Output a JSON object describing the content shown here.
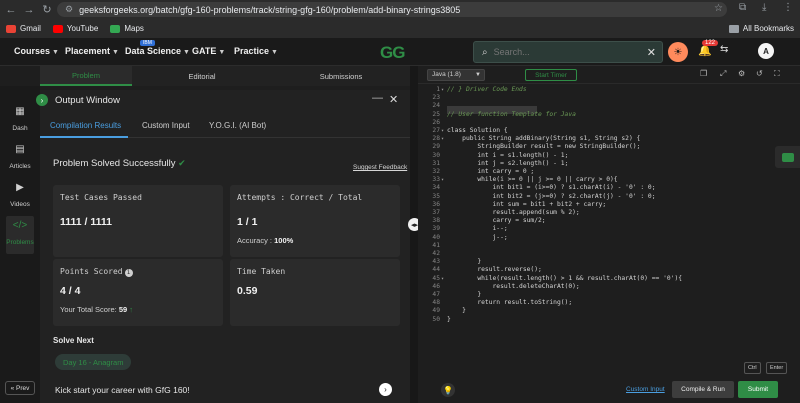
{
  "browser": {
    "url": "geeksforgeeks.org/batch/gfg-160-problems/track/string-gfg-160/problem/add-binary-strings3805",
    "bookmarks": [
      {
        "label": "Gmail",
        "color": "#ea4335"
      },
      {
        "label": "YouTube",
        "color": "#ff0000"
      },
      {
        "label": "Maps",
        "color": "#34a853"
      }
    ],
    "all_bookmarks": "All Bookmarks"
  },
  "nav": {
    "menus": [
      "Courses",
      "Placement",
      "Data Science",
      "GATE",
      "Practice"
    ],
    "ibm_badge": "IBM",
    "logo": "GG",
    "search_placeholder": "Search...",
    "notification_count": "122",
    "avatar_initial": "A"
  },
  "left_tabs": [
    "Problem",
    "Editorial",
    "Submissions"
  ],
  "sidebar": [
    "Dash",
    "Articles",
    "Videos",
    "Problems"
  ],
  "prev_label": "« Prev",
  "output": {
    "title": "Output Window",
    "tabs": [
      "Compilation Results",
      "Custom Input",
      "Y.O.G.I. (AI Bot)"
    ],
    "status": "Problem Solved Successfully",
    "feedback": "Suggest Feedback",
    "test_cases_label": "Test Cases Passed",
    "test_cases_value": "1111 / 1111",
    "attempts_label": "Attempts : Correct / Total",
    "attempts_value": "1 / 1",
    "accuracy_label": "Accuracy :",
    "accuracy_value": "100%",
    "points_label": "Points Scored",
    "points_value": "4 / 4",
    "total_score_label": "Your Total Score:",
    "total_score_value": "59",
    "time_label": "Time Taken",
    "time_value": "0.59",
    "solve_next": "Solve Next",
    "next_chip": "Day 16 - Anagram",
    "kickstart": "Kick start your career with GfG 160!"
  },
  "editor": {
    "language": "Java (1.8)",
    "timer": "Start Timer",
    "lines": [
      {
        "n": "1",
        "t": "// } Driver Code Ends",
        "c": true,
        "f": true
      },
      {
        "n": "23",
        "t": ""
      },
      {
        "n": "24",
        "t": ""
      },
      {
        "n": "25",
        "t": "// User function Template for Java",
        "c": true
      },
      {
        "n": "26",
        "t": ""
      },
      {
        "n": "27",
        "t": "class Solution {",
        "f": true
      },
      {
        "n": "28",
        "t": "    public String addBinary(String s1, String s2) {",
        "f": true
      },
      {
        "n": "29",
        "t": "        StringBuilder result = new StringBuilder();"
      },
      {
        "n": "30",
        "t": "        int i = s1.length() - 1;"
      },
      {
        "n": "31",
        "t": "        int j = s2.length() - 1;"
      },
      {
        "n": "32",
        "t": "        int carry = 0 ;"
      },
      {
        "n": "33",
        "t": "        while(i >= 0 || j >= 0 || carry > 0){",
        "f": true
      },
      {
        "n": "34",
        "t": "            int bit1 = (i>=0) ? s1.charAt(i) - '0' : 0;"
      },
      {
        "n": "35",
        "t": "            int bit2 = (j>=0) ? s2.charAt(j) - '0' : 0;"
      },
      {
        "n": "36",
        "t": "            int sum = bit1 + bit2 + carry;"
      },
      {
        "n": "37",
        "t": "            result.append(sum % 2);"
      },
      {
        "n": "38",
        "t": "            carry = sum/2;"
      },
      {
        "n": "39",
        "t": "            i--;"
      },
      {
        "n": "40",
        "t": "            j--;"
      },
      {
        "n": "41",
        "t": ""
      },
      {
        "n": "42",
        "t": ""
      },
      {
        "n": "43",
        "t": "        }"
      },
      {
        "n": "44",
        "t": "        result.reverse();"
      },
      {
        "n": "45",
        "t": "        while(result.length() > 1 && result.charAt(0) == '0'){",
        "f": true
      },
      {
        "n": "46",
        "t": "            result.deleteCharAt(0);"
      },
      {
        "n": "47",
        "t": "        }"
      },
      {
        "n": "48",
        "t": "        return result.toString();"
      },
      {
        "n": "49",
        "t": "    }"
      },
      {
        "n": "50",
        "t": "}"
      }
    ],
    "kbd1": "Ctrl",
    "kbd2": "Enter",
    "custom_input": "Custom Input",
    "compile": "Compile & Run",
    "submit": "Submit"
  },
  "colors": {
    "accent": "#2f8d46",
    "link": "#4a9ee0",
    "bg": "#1e1e1e"
  }
}
